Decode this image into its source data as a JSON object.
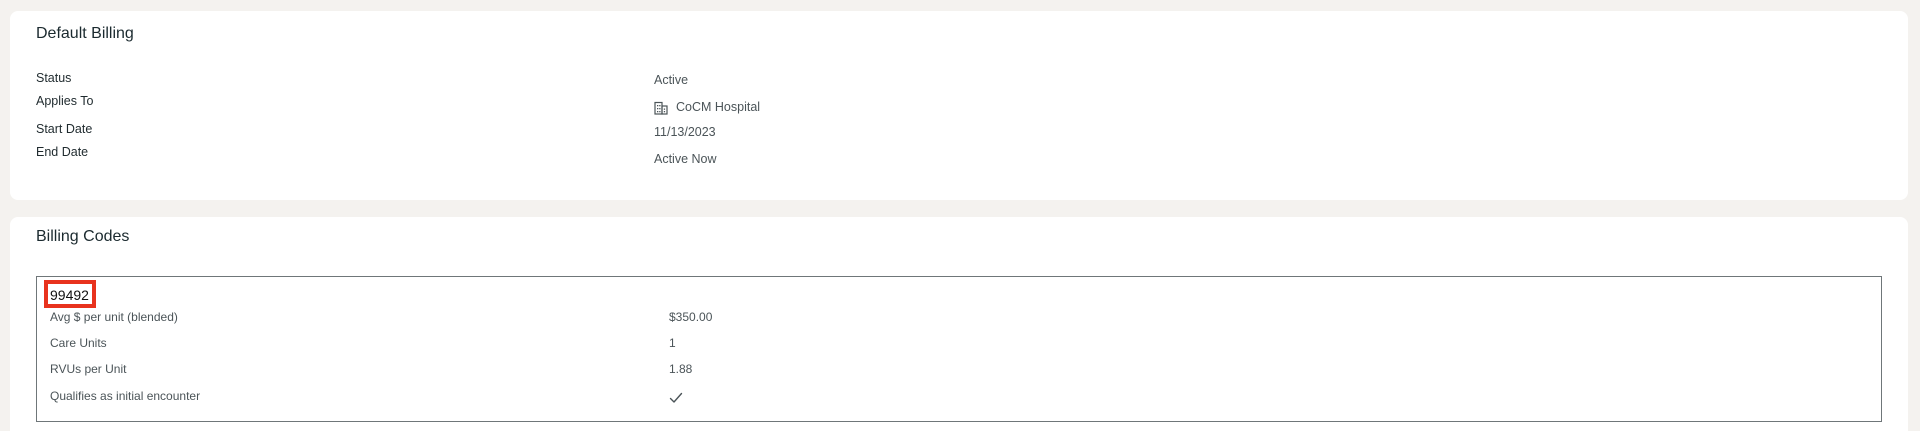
{
  "default_billing": {
    "title": "Default Billing",
    "rows": [
      {
        "label": "Status",
        "value": "Active"
      },
      {
        "label": "Applies To",
        "value": "CoCM Hospital",
        "icon": "building-icon"
      },
      {
        "label": "Start Date",
        "value": "11/13/2023"
      },
      {
        "label": "End Date",
        "value": "Active Now"
      }
    ]
  },
  "billing_codes": {
    "title": "Billing Codes",
    "codes": [
      {
        "code": "99492",
        "highlight_color": "#e8321d",
        "rows": [
          {
            "label": "Avg $ per unit (blended)",
            "value": "$350.00"
          },
          {
            "label": "Care Units",
            "value": "1"
          },
          {
            "label": "RVUs per Unit",
            "value": "1.88"
          },
          {
            "label": "Qualifies as initial encounter",
            "value_icon": "check-icon"
          }
        ]
      }
    ]
  }
}
